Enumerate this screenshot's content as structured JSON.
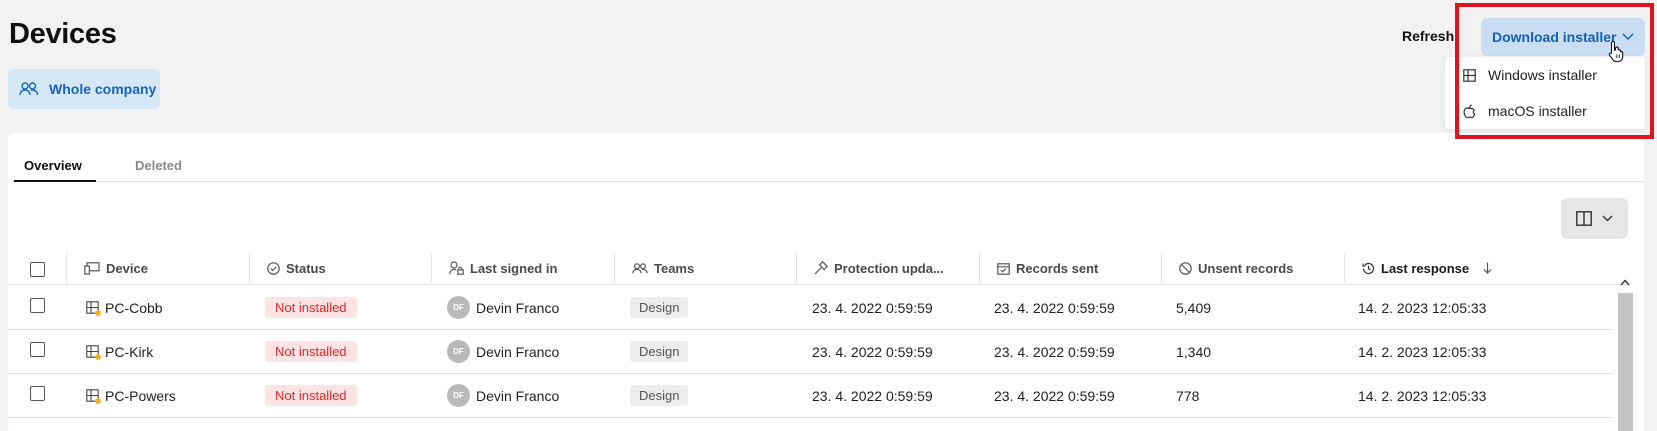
{
  "header": {
    "title": "Devices",
    "scope_label": "Whole company",
    "refresh_label": "Refresh",
    "download_label": "Download installer"
  },
  "download_menu": {
    "items": [
      {
        "label": "Windows installer",
        "icon": "windows-icon"
      },
      {
        "label": "macOS installer",
        "icon": "apple-icon"
      }
    ]
  },
  "tabs": [
    {
      "label": "Overview",
      "active": true
    },
    {
      "label": "Deleted",
      "active": false
    }
  ],
  "table": {
    "columns": [
      {
        "label": "Device",
        "icon": "device-icon"
      },
      {
        "label": "Status",
        "icon": "check-circle-icon"
      },
      {
        "label": "Last signed in",
        "icon": "user-lock-icon"
      },
      {
        "label": "Teams",
        "icon": "team-icon"
      },
      {
        "label": "Protection upda...",
        "icon": "hammer-icon"
      },
      {
        "label": "Records sent",
        "icon": "calendar-check-icon"
      },
      {
        "label": "Unsent records",
        "icon": "block-icon"
      },
      {
        "label": "Last response",
        "icon": "history-icon",
        "sorted": "desc"
      }
    ],
    "rows": [
      {
        "device": "PC-Cobb",
        "status": "Not installed",
        "initials": "DF",
        "user": "Devin Franco",
        "team": "Design",
        "protection_update": "23. 4. 2022 0:59:59",
        "records_sent": "23. 4. 2022 0:59:59",
        "unsent_records": "5,409",
        "last_response": "14. 2. 2023 12:05:33"
      },
      {
        "device": "PC-Kirk",
        "status": "Not installed",
        "initials": "DF",
        "user": "Devin Franco",
        "team": "Design",
        "protection_update": "23. 4. 2022 0:59:59",
        "records_sent": "23. 4. 2022 0:59:59",
        "unsent_records": "1,340",
        "last_response": "14. 2. 2023 12:05:33"
      },
      {
        "device": "PC-Powers",
        "status": "Not installed",
        "initials": "DF",
        "user": "Devin Franco",
        "team": "Design",
        "protection_update": "23. 4. 2022 0:59:59",
        "records_sent": "23. 4. 2022 0:59:59",
        "unsent_records": "778",
        "last_response": "14. 2. 2023 12:05:33"
      }
    ]
  },
  "colors": {
    "accent": "#1560b7",
    "accent_bg": "#c9def2",
    "status_error_text": "#d62b2b",
    "status_error_bg": "#fde3e3",
    "highlight": "#e0141e"
  }
}
